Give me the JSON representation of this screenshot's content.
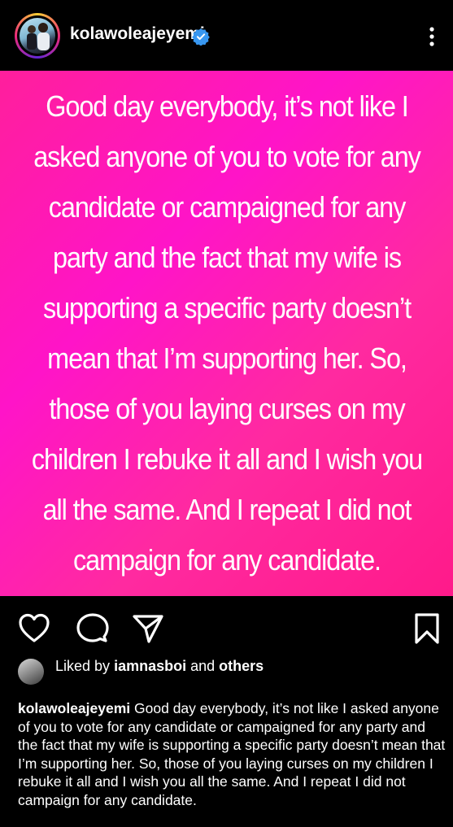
{
  "header": {
    "username": "kolawoleajeyemi",
    "verified": true,
    "avatar_icon": "profile-photo",
    "more_icon": "more-vertical-icon"
  },
  "post": {
    "background_colors": [
      "#ff1f9c",
      "#ff14c8",
      "#ff1a8a"
    ],
    "text": "Good day everybody, it’s not like I asked anyone of you to vote for any candidate or campaigned for any party and the fact that my wife is supporting a specific party doesn’t mean that I’m supporting her. So, those of you laying curses on my children I rebuke it all and I wish you all the same. And I repeat I did not campaign for any candidate."
  },
  "actions": {
    "like_icon": "heart-icon",
    "comment_icon": "comment-icon",
    "share_icon": "share-icon",
    "save_icon": "bookmark-icon"
  },
  "likes": {
    "prefix": "Liked by",
    "liker": "iamnasboi",
    "connector": "and",
    "others": "others"
  },
  "caption": {
    "username": "kolawoleajeyemi",
    "text": "Good day everybody, it’s not like I asked anyone of you to vote for any candidate or campaigned for any party and the fact that my wife is supporting a specific party doesn’t mean that I’m supporting her. So, those of you laying curses on my children I rebuke it all and I wish you all the same. And I repeat I did not campaign for any candidate."
  }
}
